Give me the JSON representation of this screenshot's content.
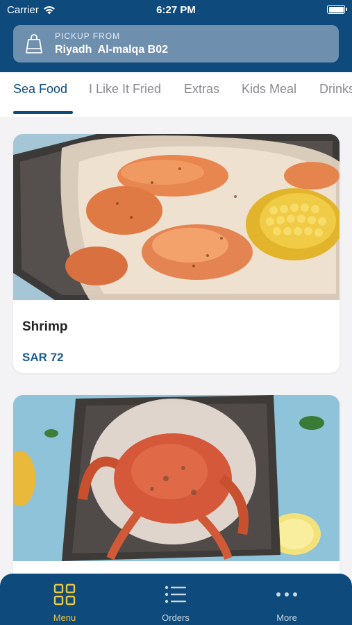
{
  "status_bar": {
    "carrier": "Carrier",
    "time": "6:27 PM"
  },
  "pickup": {
    "label": "PICKUP FROM",
    "location": "Riyadh  Al-malqa B02",
    "icon": "shopping-bag-icon"
  },
  "tabs": [
    {
      "label": "Sea Food",
      "active": true
    },
    {
      "label": "I Like It Fried",
      "active": false
    },
    {
      "label": "Extras",
      "active": false
    },
    {
      "label": "Kids Meal",
      "active": false
    },
    {
      "label": "Drinks",
      "active": false
    }
  ],
  "menu_items": [
    {
      "name": "Shrimp",
      "price": "SAR 72"
    },
    {
      "name": "",
      "price": ""
    }
  ],
  "bottom_nav": [
    {
      "label": "Menu",
      "icon": "grid-icon",
      "active": true
    },
    {
      "label": "Orders",
      "icon": "list-icon",
      "active": false
    },
    {
      "label": "More",
      "icon": "more-icon",
      "active": false
    }
  ],
  "colors": {
    "primary": "#0e4a7c",
    "accent": "#f0c53a",
    "price": "#1c5c8e"
  }
}
